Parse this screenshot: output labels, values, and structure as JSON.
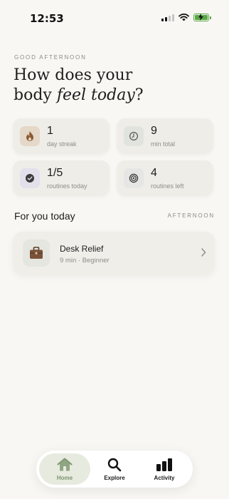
{
  "status_bar": {
    "time": "12:53",
    "icons": [
      "cellular-signal-icon",
      "wifi-icon",
      "battery-charging-icon"
    ]
  },
  "greeting": {
    "eyebrow": "GOOD AFTERNOON",
    "headline_line1": "How does your",
    "headline_line2_plain": "body ",
    "headline_line2_italic": "feel today",
    "headline_line2_end": "?"
  },
  "stats": [
    {
      "value": "1",
      "label": "day streak",
      "icon": "flame-icon",
      "icon_bg": "#e4d8c8"
    },
    {
      "value": "9",
      "label": "min total",
      "icon": "clock-icon",
      "icon_bg": "#e0e4dc"
    },
    {
      "value": "1/5",
      "label": "routines today",
      "icon": "check-circle-icon",
      "icon_bg": "#e3e0ec"
    },
    {
      "value": "4",
      "label": "routines left",
      "icon": "target-icon",
      "icon_bg": "#e6e6e4"
    }
  ],
  "section": {
    "title": "For you today",
    "tag": "AFTERNOON"
  },
  "routine": {
    "title": "Desk Relief",
    "meta": "9 min · Beginner",
    "icon": "briefcase-icon"
  },
  "tabs": [
    {
      "label": "Home",
      "icon": "home-icon",
      "active": true
    },
    {
      "label": "Explore",
      "icon": "search-icon",
      "active": false
    },
    {
      "label": "Activity",
      "icon": "bar-chart-icon",
      "active": false
    }
  ],
  "colors": {
    "background": "#f8f7f3",
    "card": "#efede8",
    "accent": "#7c9470",
    "battery": "#5aa845"
  }
}
